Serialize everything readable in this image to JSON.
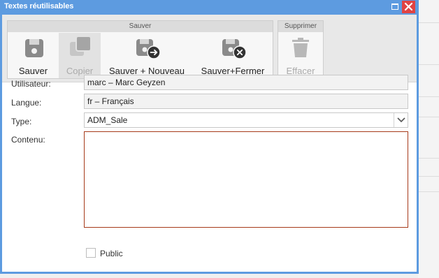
{
  "window": {
    "title": "Textes réutilisables",
    "maximize_label": "maximize",
    "close_label": "close"
  },
  "ribbon": {
    "save_group": {
      "header": "Sauver",
      "buttons": [
        {
          "label": "Sauver",
          "icon": "floppy-disk-icon",
          "enabled": true
        },
        {
          "label": "Copier",
          "icon": "copy-icon",
          "enabled": false
        },
        {
          "label": "Sauver + Nouveau",
          "icon": "save-new-icon",
          "enabled": true
        },
        {
          "label": "Sauver+Fermer",
          "icon": "save-close-icon",
          "enabled": true
        }
      ]
    },
    "delete_group": {
      "header": "Supprimer",
      "buttons": [
        {
          "label": "Effacer",
          "icon": "trash-icon",
          "enabled": false
        }
      ]
    }
  },
  "form": {
    "user": {
      "label": "Utilisateur:",
      "value": "marc – Marc Geyzen"
    },
    "language": {
      "label": "Langue:",
      "value": "fr – Français"
    },
    "type": {
      "label": "Type:",
      "value": "ADM_Sale"
    },
    "content": {
      "label": "Contenu:",
      "value": ""
    },
    "public": {
      "label": "Public",
      "checked": false
    }
  },
  "colors": {
    "titlebar": "#5d9be0",
    "close_button": "#e04343",
    "content_border": "#a63a1a"
  }
}
